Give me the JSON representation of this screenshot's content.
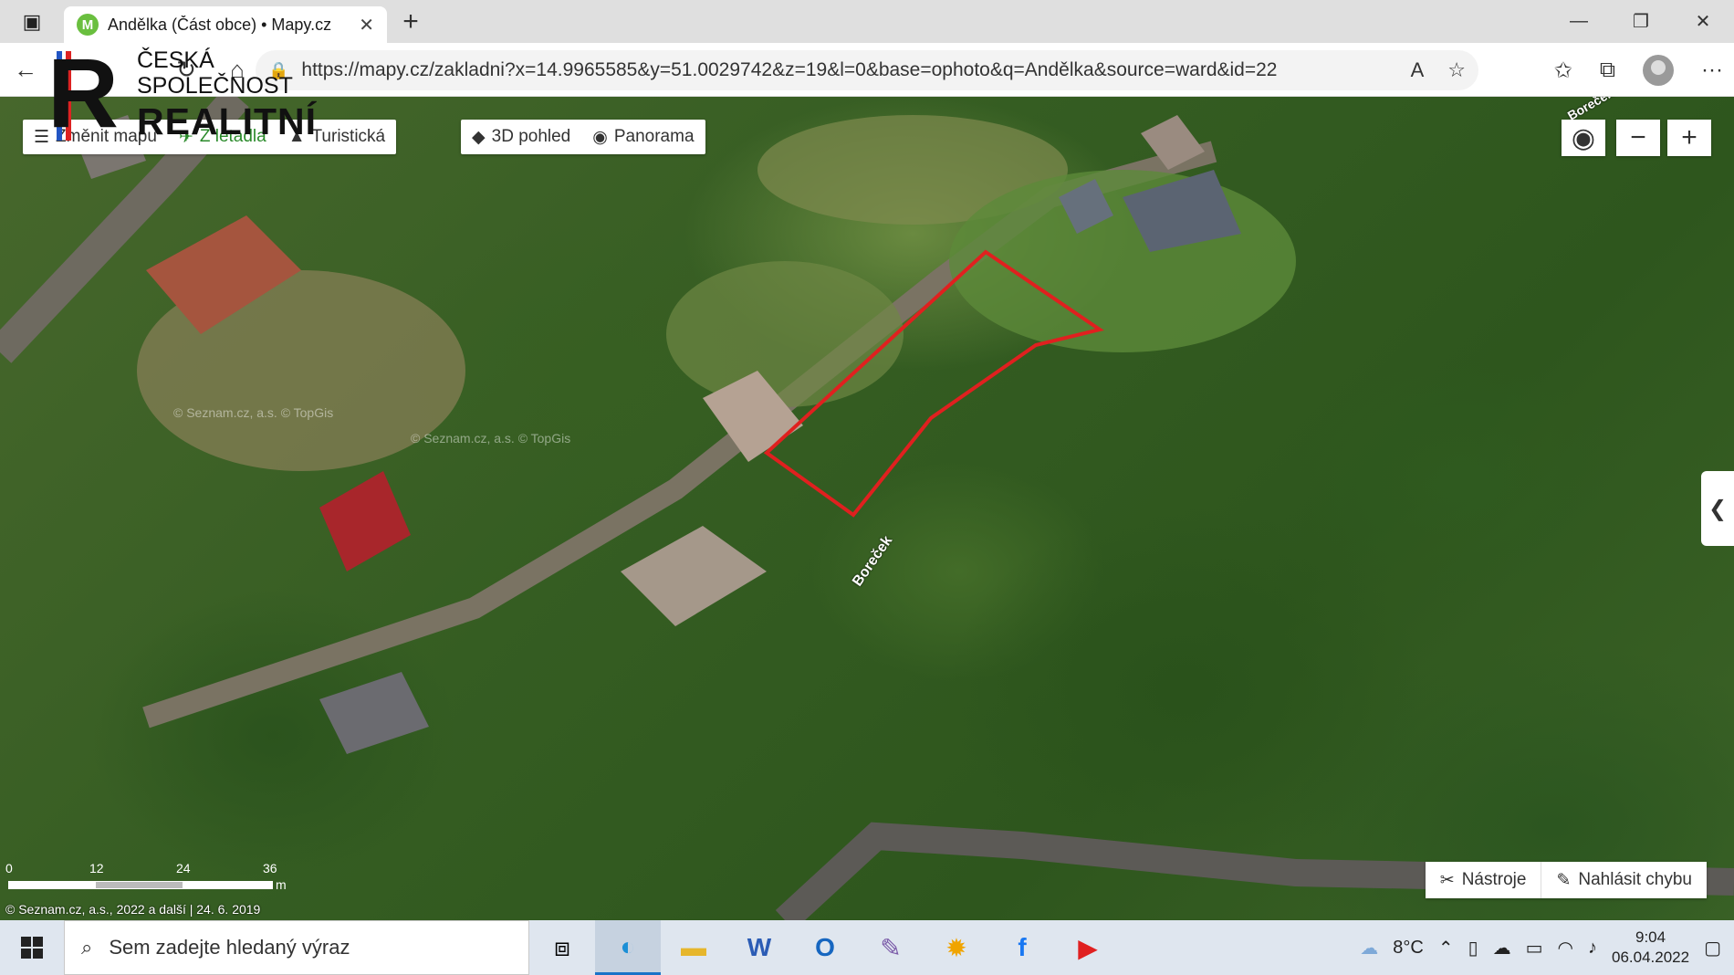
{
  "browser": {
    "tab_title": "Andělka (Část obce) • Mapy.cz",
    "favicon_letter": "M",
    "url": "https://mapy.cz/zakladni?x=14.9965585&y=51.0029742&z=19&l=0&base=ophoto&q=Andělka&source=ward&id=22"
  },
  "watermark": {
    "line1": "ČESKÁ",
    "line2": "SPOLEČNOST",
    "line3": "REALITNÍ",
    "letter": "R"
  },
  "map_controls": {
    "change_map": "Změnit mapu",
    "aerial": "Z letadla",
    "tourist": "Turistická",
    "view_3d": "3D pohled",
    "panorama": "Panorama"
  },
  "map_labels": {
    "street1": "Boreček",
    "street2": "Boreček",
    "watermark1": "© Seznam.cz, a.s. © TopGis",
    "watermark2": "© Seznam.cz, a.s. © TopGis"
  },
  "scale": {
    "t0": "0",
    "t1": "12",
    "t2": "24",
    "t3": "36",
    "unit": "m"
  },
  "copyright": "© Seznam.cz, a.s., 2022 a další | 24. 6. 2019",
  "tools": {
    "tools_label": "Nástroje",
    "report_label": "Nahlásit chybu"
  },
  "taskbar": {
    "search_placeholder": "Sem zadejte hledaný výraz",
    "temperature": "8°C",
    "time": "9:04",
    "date": "06.04.2022"
  },
  "colors": {
    "plot_outline": "#e0201f",
    "accent_green": "#2a8a2a"
  }
}
